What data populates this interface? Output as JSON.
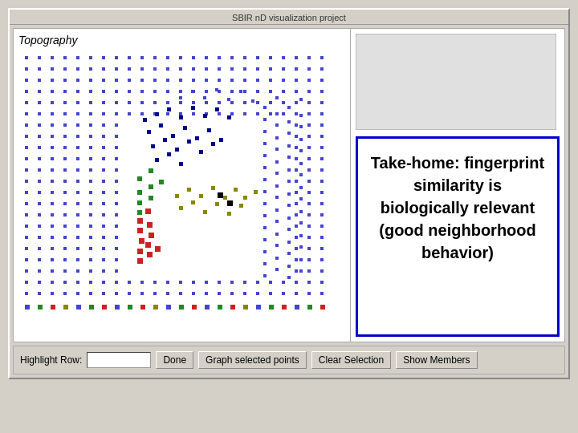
{
  "window": {
    "title": "SBIR nD visualization project"
  },
  "left_panel": {
    "label": "Topography"
  },
  "right_panel": {
    "callout_text": "Take-home: fingerprint similarity is biologically relevant (good neighborhood behavior)"
  },
  "bottom_bar": {
    "highlight_label": "Highlight Row:",
    "highlight_placeholder": "",
    "done_label": "Done",
    "graph_label": "Graph selected points",
    "clear_label": "Clear Selection",
    "members_label": "Show Members"
  },
  "scatter": {
    "blue_dots": [
      [
        20,
        10
      ],
      [
        35,
        10
      ],
      [
        50,
        10
      ],
      [
        65,
        10
      ],
      [
        80,
        10
      ],
      [
        95,
        10
      ],
      [
        110,
        10
      ],
      [
        125,
        10
      ],
      [
        140,
        10
      ],
      [
        155,
        10
      ],
      [
        170,
        10
      ],
      [
        185,
        10
      ],
      [
        200,
        10
      ],
      [
        215,
        10
      ],
      [
        230,
        10
      ],
      [
        245,
        10
      ],
      [
        260,
        10
      ],
      [
        275,
        10
      ],
      [
        290,
        10
      ],
      [
        305,
        10
      ],
      [
        320,
        10
      ],
      [
        335,
        10
      ],
      [
        350,
        10
      ],
      [
        365,
        10
      ],
      [
        20,
        25
      ],
      [
        35,
        25
      ],
      [
        50,
        25
      ],
      [
        65,
        25
      ],
      [
        80,
        25
      ],
      [
        95,
        25
      ],
      [
        110,
        25
      ],
      [
        125,
        25
      ],
      [
        140,
        25
      ],
      [
        155,
        25
      ],
      [
        170,
        25
      ],
      [
        185,
        25
      ],
      [
        200,
        25
      ],
      [
        215,
        25
      ],
      [
        230,
        25
      ],
      [
        245,
        25
      ],
      [
        260,
        25
      ],
      [
        275,
        25
      ],
      [
        290,
        25
      ],
      [
        305,
        25
      ],
      [
        320,
        25
      ],
      [
        335,
        25
      ],
      [
        350,
        25
      ],
      [
        365,
        25
      ],
      [
        20,
        40
      ],
      [
        35,
        40
      ],
      [
        50,
        40
      ],
      [
        65,
        40
      ],
      [
        80,
        40
      ],
      [
        95,
        40
      ],
      [
        110,
        40
      ],
      [
        125,
        40
      ],
      [
        140,
        40
      ],
      [
        155,
        40
      ],
      [
        170,
        40
      ],
      [
        185,
        40
      ],
      [
        200,
        40
      ],
      [
        215,
        40
      ],
      [
        230,
        40
      ],
      [
        245,
        40
      ],
      [
        260,
        40
      ],
      [
        275,
        40
      ],
      [
        290,
        40
      ],
      [
        305,
        40
      ],
      [
        320,
        40
      ],
      [
        335,
        40
      ],
      [
        350,
        40
      ],
      [
        365,
        40
      ],
      [
        20,
        55
      ],
      [
        35,
        55
      ],
      [
        50,
        55
      ],
      [
        65,
        55
      ],
      [
        80,
        55
      ],
      [
        95,
        55
      ],
      [
        110,
        55
      ],
      [
        125,
        55
      ],
      [
        140,
        55
      ],
      [
        155,
        55
      ],
      [
        365,
        55
      ],
      [
        20,
        70
      ],
      [
        35,
        70
      ],
      [
        50,
        70
      ],
      [
        65,
        70
      ],
      [
        80,
        70
      ],
      [
        95,
        70
      ],
      [
        110,
        70
      ],
      [
        125,
        70
      ],
      [
        140,
        70
      ],
      [
        365,
        70
      ],
      [
        20,
        85
      ],
      [
        35,
        85
      ],
      [
        50,
        85
      ],
      [
        65,
        85
      ],
      [
        80,
        85
      ],
      [
        95,
        85
      ],
      [
        110,
        85
      ],
      [
        365,
        85
      ],
      [
        20,
        100
      ],
      [
        35,
        100
      ],
      [
        50,
        100
      ],
      [
        65,
        100
      ],
      [
        80,
        100
      ],
      [
        365,
        100
      ],
      [
        20,
        115
      ],
      [
        35,
        115
      ],
      [
        50,
        115
      ],
      [
        65,
        115
      ],
      [
        365,
        115
      ],
      [
        20,
        130
      ],
      [
        35,
        130
      ],
      [
        50,
        130
      ],
      [
        365,
        130
      ],
      [
        20,
        145
      ],
      [
        35,
        145
      ],
      [
        365,
        145
      ],
      [
        20,
        160
      ],
      [
        365,
        160
      ],
      [
        20,
        175
      ],
      [
        365,
        175
      ],
      [
        20,
        190
      ],
      [
        365,
        190
      ],
      [
        20,
        205
      ],
      [
        365,
        205
      ],
      [
        20,
        220
      ],
      [
        365,
        220
      ],
      [
        20,
        235
      ],
      [
        365,
        235
      ],
      [
        20,
        250
      ],
      [
        365,
        250
      ],
      [
        20,
        265
      ],
      [
        365,
        265
      ],
      [
        20,
        280
      ],
      [
        365,
        280
      ],
      [
        20,
        295
      ],
      [
        35,
        295
      ],
      [
        365,
        295
      ],
      [
        20,
        310
      ],
      [
        35,
        310
      ],
      [
        50,
        310
      ],
      [
        365,
        310
      ],
      [
        20,
        325
      ],
      [
        35,
        325
      ],
      [
        50,
        325
      ],
      [
        65,
        325
      ],
      [
        80,
        325
      ],
      [
        95,
        325
      ],
      [
        110,
        325
      ],
      [
        125,
        325
      ],
      [
        305,
        325
      ],
      [
        320,
        325
      ],
      [
        335,
        325
      ],
      [
        350,
        325
      ],
      [
        365,
        325
      ]
    ],
    "cluster_area": {
      "blue_cluster": [
        [
          160,
          120
        ],
        [
          175,
          110
        ],
        [
          190,
          100
        ],
        [
          205,
          115
        ],
        [
          220,
          105
        ],
        [
          235,
          120
        ],
        [
          250,
          110
        ],
        [
          165,
          135
        ],
        [
          180,
          125
        ],
        [
          200,
          130
        ],
        [
          215,
          140
        ],
        [
          230,
          130
        ],
        [
          245,
          145
        ]
      ],
      "green_cluster": [
        [
          155,
          155
        ],
        [
          170,
          145
        ],
        [
          185,
          155
        ],
        [
          165,
          170
        ],
        [
          180,
          165
        ],
        [
          170,
          180
        ]
      ],
      "red_cluster": [
        [
          150,
          195
        ],
        [
          165,
          185
        ],
        [
          155,
          205
        ],
        [
          168,
          200
        ],
        [
          160,
          215
        ],
        [
          175,
          205
        ],
        [
          165,
          220
        ],
        [
          178,
          215
        ]
      ],
      "olive_cluster": [
        [
          200,
          195
        ],
        [
          215,
          185
        ],
        [
          225,
          200
        ],
        [
          240,
          190
        ],
        [
          255,
          200
        ],
        [
          265,
          195
        ],
        [
          280,
          205
        ]
      ],
      "black_cluster": [
        [
          250,
          195
        ],
        [
          265,
          210
        ]
      ]
    }
  }
}
